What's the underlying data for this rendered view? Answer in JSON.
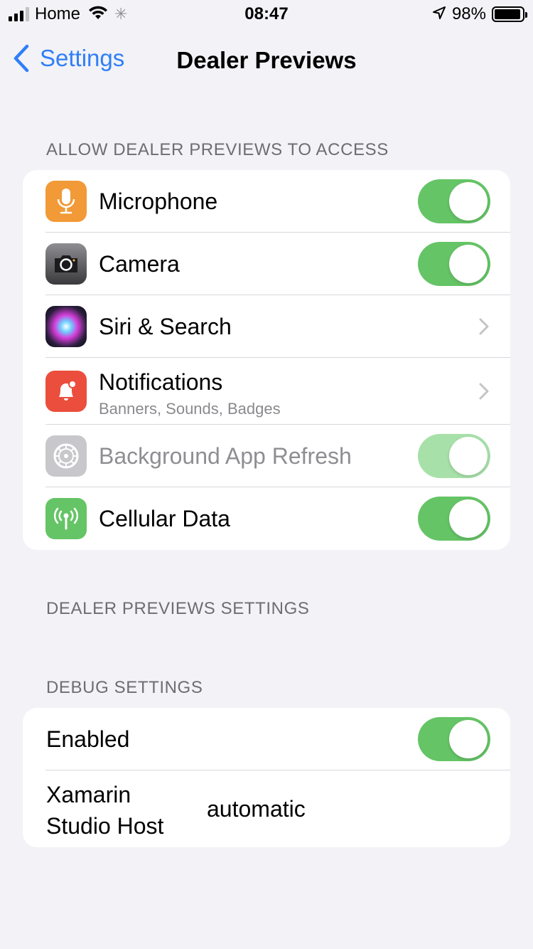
{
  "status_bar": {
    "carrier": "Home",
    "time": "08:47",
    "battery_percent": "98%"
  },
  "nav": {
    "back_label": "Settings",
    "title": "Dealer Previews"
  },
  "access_section": {
    "header": "ALLOW DEALER PREVIEWS TO ACCESS",
    "items": [
      {
        "label": "Microphone",
        "icon": "microphone-icon",
        "icon_color": "#f19a37",
        "control": "toggle",
        "on": true
      },
      {
        "label": "Camera",
        "icon": "camera-icon",
        "icon_color": "#5c5c5e",
        "control": "toggle",
        "on": true
      },
      {
        "label": "Siri & Search",
        "icon": "siri-icon",
        "icon_color": "#1a1a2e",
        "control": "chevron"
      },
      {
        "label": "Notifications",
        "sublabel": "Banners, Sounds, Badges",
        "icon": "notification-bell-icon",
        "icon_color": "#eb4e3d",
        "control": "chevron"
      },
      {
        "label": "Background App Refresh",
        "icon": "gear-icon",
        "icon_color": "#c7c7cc",
        "control": "toggle",
        "on": true,
        "disabled": true
      },
      {
        "label": "Cellular Data",
        "icon": "antenna-icon",
        "icon_color": "#65c466",
        "control": "toggle",
        "on": true
      }
    ]
  },
  "app_settings_section": {
    "header": "DEALER PREVIEWS SETTINGS"
  },
  "debug_section": {
    "header": "DEBUG SETTINGS",
    "enabled_label": "Enabled",
    "enabled_on": true,
    "host_label_line1": "Xamarin",
    "host_label_line2": "Studio Host",
    "host_value": "automatic"
  },
  "colors": {
    "accent": "#2f7ff6",
    "toggle_on": "#65c466",
    "background": "#f2f2f7"
  }
}
